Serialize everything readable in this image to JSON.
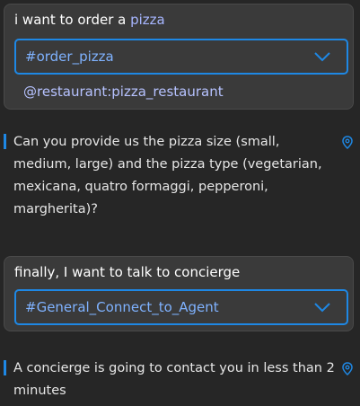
{
  "cards": [
    {
      "title_prefix": "i want to order a ",
      "title_entity": "pizza",
      "intent": "#order_pizza",
      "entity": "@restaurant:pizza_restaurant"
    },
    {
      "title_prefix": "finally, I want to talk to concierge",
      "intent": "#General_Connect_to_Agent"
    }
  ],
  "responses": [
    {
      "text": "Can you provide us the pizza size (small, medium, large) and the pizza type (vegetarian, mexicana, quatro formaggi, pepperoni, margherita)?"
    },
    {
      "text": "A concierge is going to contact you in less than 2 minutes"
    }
  ],
  "colors": {
    "accent": "#1e88e5",
    "entity": "#a7b6ff",
    "background": "#262626",
    "card": "#3a3a3a"
  }
}
